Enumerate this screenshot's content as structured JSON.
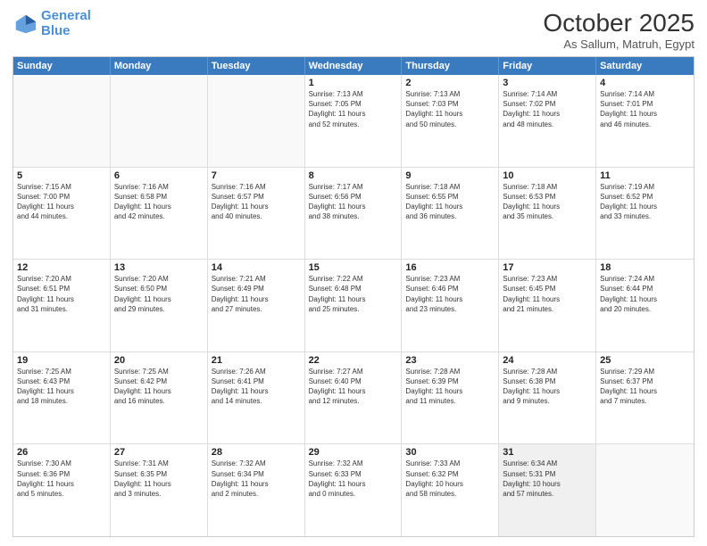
{
  "header": {
    "logo_line1": "General",
    "logo_line2": "Blue",
    "month": "October 2025",
    "location": "As Sallum, Matruh, Egypt"
  },
  "days_of_week": [
    "Sunday",
    "Monday",
    "Tuesday",
    "Wednesday",
    "Thursday",
    "Friday",
    "Saturday"
  ],
  "weeks": [
    [
      {
        "day": "",
        "details": ""
      },
      {
        "day": "",
        "details": ""
      },
      {
        "day": "",
        "details": ""
      },
      {
        "day": "1",
        "details": "Sunrise: 7:13 AM\nSunset: 7:05 PM\nDaylight: 11 hours\nand 52 minutes."
      },
      {
        "day": "2",
        "details": "Sunrise: 7:13 AM\nSunset: 7:03 PM\nDaylight: 11 hours\nand 50 minutes."
      },
      {
        "day": "3",
        "details": "Sunrise: 7:14 AM\nSunset: 7:02 PM\nDaylight: 11 hours\nand 48 minutes."
      },
      {
        "day": "4",
        "details": "Sunrise: 7:14 AM\nSunset: 7:01 PM\nDaylight: 11 hours\nand 46 minutes."
      }
    ],
    [
      {
        "day": "5",
        "details": "Sunrise: 7:15 AM\nSunset: 7:00 PM\nDaylight: 11 hours\nand 44 minutes."
      },
      {
        "day": "6",
        "details": "Sunrise: 7:16 AM\nSunset: 6:58 PM\nDaylight: 11 hours\nand 42 minutes."
      },
      {
        "day": "7",
        "details": "Sunrise: 7:16 AM\nSunset: 6:57 PM\nDaylight: 11 hours\nand 40 minutes."
      },
      {
        "day": "8",
        "details": "Sunrise: 7:17 AM\nSunset: 6:56 PM\nDaylight: 11 hours\nand 38 minutes."
      },
      {
        "day": "9",
        "details": "Sunrise: 7:18 AM\nSunset: 6:55 PM\nDaylight: 11 hours\nand 36 minutes."
      },
      {
        "day": "10",
        "details": "Sunrise: 7:18 AM\nSunset: 6:53 PM\nDaylight: 11 hours\nand 35 minutes."
      },
      {
        "day": "11",
        "details": "Sunrise: 7:19 AM\nSunset: 6:52 PM\nDaylight: 11 hours\nand 33 minutes."
      }
    ],
    [
      {
        "day": "12",
        "details": "Sunrise: 7:20 AM\nSunset: 6:51 PM\nDaylight: 11 hours\nand 31 minutes."
      },
      {
        "day": "13",
        "details": "Sunrise: 7:20 AM\nSunset: 6:50 PM\nDaylight: 11 hours\nand 29 minutes."
      },
      {
        "day": "14",
        "details": "Sunrise: 7:21 AM\nSunset: 6:49 PM\nDaylight: 11 hours\nand 27 minutes."
      },
      {
        "day": "15",
        "details": "Sunrise: 7:22 AM\nSunset: 6:48 PM\nDaylight: 11 hours\nand 25 minutes."
      },
      {
        "day": "16",
        "details": "Sunrise: 7:23 AM\nSunset: 6:46 PM\nDaylight: 11 hours\nand 23 minutes."
      },
      {
        "day": "17",
        "details": "Sunrise: 7:23 AM\nSunset: 6:45 PM\nDaylight: 11 hours\nand 21 minutes."
      },
      {
        "day": "18",
        "details": "Sunrise: 7:24 AM\nSunset: 6:44 PM\nDaylight: 11 hours\nand 20 minutes."
      }
    ],
    [
      {
        "day": "19",
        "details": "Sunrise: 7:25 AM\nSunset: 6:43 PM\nDaylight: 11 hours\nand 18 minutes."
      },
      {
        "day": "20",
        "details": "Sunrise: 7:25 AM\nSunset: 6:42 PM\nDaylight: 11 hours\nand 16 minutes."
      },
      {
        "day": "21",
        "details": "Sunrise: 7:26 AM\nSunset: 6:41 PM\nDaylight: 11 hours\nand 14 minutes."
      },
      {
        "day": "22",
        "details": "Sunrise: 7:27 AM\nSunset: 6:40 PM\nDaylight: 11 hours\nand 12 minutes."
      },
      {
        "day": "23",
        "details": "Sunrise: 7:28 AM\nSunset: 6:39 PM\nDaylight: 11 hours\nand 11 minutes."
      },
      {
        "day": "24",
        "details": "Sunrise: 7:28 AM\nSunset: 6:38 PM\nDaylight: 11 hours\nand 9 minutes."
      },
      {
        "day": "25",
        "details": "Sunrise: 7:29 AM\nSunset: 6:37 PM\nDaylight: 11 hours\nand 7 minutes."
      }
    ],
    [
      {
        "day": "26",
        "details": "Sunrise: 7:30 AM\nSunset: 6:36 PM\nDaylight: 11 hours\nand 5 minutes."
      },
      {
        "day": "27",
        "details": "Sunrise: 7:31 AM\nSunset: 6:35 PM\nDaylight: 11 hours\nand 3 minutes."
      },
      {
        "day": "28",
        "details": "Sunrise: 7:32 AM\nSunset: 6:34 PM\nDaylight: 11 hours\nand 2 minutes."
      },
      {
        "day": "29",
        "details": "Sunrise: 7:32 AM\nSunset: 6:33 PM\nDaylight: 11 hours\nand 0 minutes."
      },
      {
        "day": "30",
        "details": "Sunrise: 7:33 AM\nSunset: 6:32 PM\nDaylight: 10 hours\nand 58 minutes."
      },
      {
        "day": "31",
        "details": "Sunrise: 6:34 AM\nSunset: 5:31 PM\nDaylight: 10 hours\nand 57 minutes."
      },
      {
        "day": "",
        "details": ""
      }
    ]
  ]
}
